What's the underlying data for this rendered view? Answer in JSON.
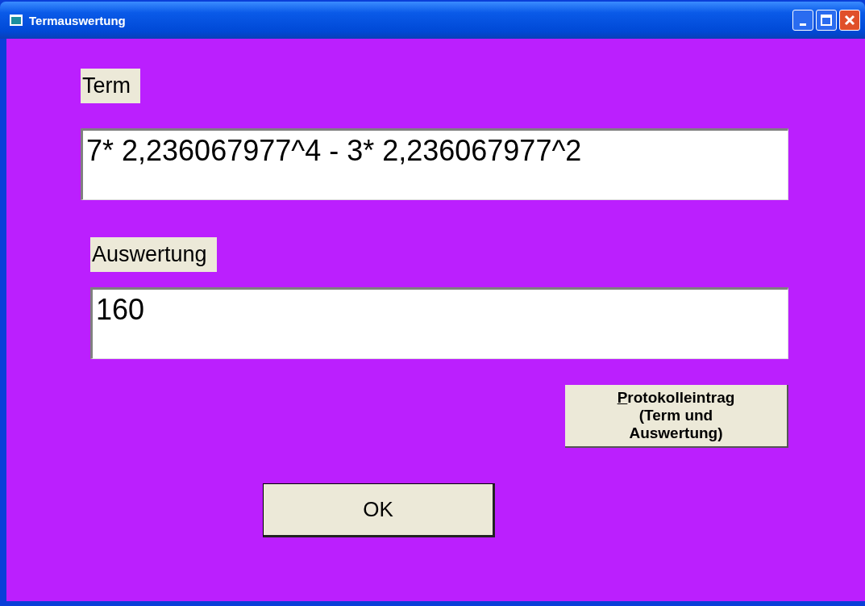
{
  "window": {
    "title": "Termauswertung"
  },
  "term": {
    "label": "Term",
    "value": "7* 2,236067977^4 - 3* 2,236067977^2"
  },
  "result": {
    "label": "Auswertung",
    "value": "160"
  },
  "log_button": {
    "lines": [
      "Protokolleintrag",
      "(Term und",
      "Auswertung)"
    ],
    "access_key_underlined": true
  },
  "ok_button": {
    "label": "OK"
  }
}
